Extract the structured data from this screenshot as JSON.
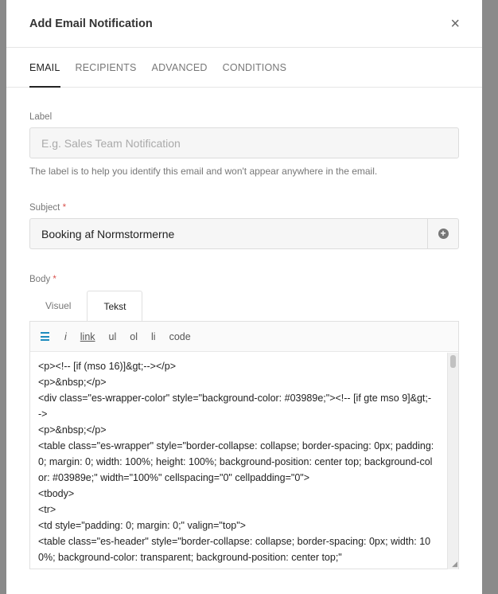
{
  "modal": {
    "title": "Add Email Notification",
    "close_symbol": "×"
  },
  "tabs": [
    "EMAIL",
    "RECIPIENTS",
    "ADVANCED",
    "CONDITIONS"
  ],
  "label_field": {
    "label": "Label",
    "placeholder": "E.g. Sales Team Notification",
    "help": "The label is to help you identify this email and won't appear anywhere in the email."
  },
  "subject_field": {
    "label": "Subject",
    "required_mark": "*",
    "value": "Booking af Normstormerne",
    "add_icon": "plus-circle-icon"
  },
  "body_field": {
    "label": "Body",
    "required_mark": "*",
    "editor_tabs": [
      "Visuel",
      "Tekst"
    ],
    "toolbar": {
      "icon": "list-icon",
      "italic": "i",
      "link": "link",
      "ul": "ul",
      "ol": "ol",
      "li": "li",
      "code": "code"
    },
    "code_lines": [
      "<p><!-- [if (mso 16)]&gt;--></p>",
      "<p>&nbsp;</p>",
      "<div class=\"es-wrapper-color\" style=\"background-color: #03989e;\"><!-- [if gte mso 9]&gt;-->",
      "<p>&nbsp;</p>",
      "<table class=\"es-wrapper\" style=\"border-collapse: collapse; border-spacing: 0px; padding: 0; margin: 0; width: 100%; height: 100%; background-position: center top; background-color: #03989e;\" width=\"100%\" cellspacing=\"0\" cellpadding=\"0\">",
      "<tbody>",
      "<tr>",
      "<td style=\"padding: 0; margin: 0;\" valign=\"top\">",
      "<table class=\"es-header\" style=\"border-collapse: collapse; border-spacing: 0px; width: 100%; background-color: transparent; background-position: center top;\""
    ]
  },
  "colors": {
    "accent": "#1e8cbe",
    "required": "#d9534f"
  }
}
